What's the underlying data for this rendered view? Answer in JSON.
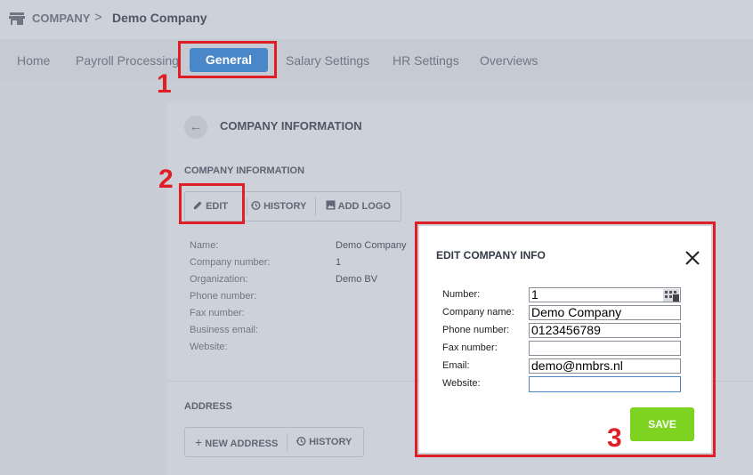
{
  "breadcrumb": {
    "root": "COMPANY",
    "separator": ">",
    "current": "Demo Company"
  },
  "nav": {
    "items": [
      "Home",
      "Payroll Processing",
      "General",
      "Salary Settings",
      "HR Settings",
      "Overviews"
    ],
    "active": "General"
  },
  "card": {
    "title": "COMPANY INFORMATION",
    "section": "COMPANY INFORMATION",
    "buttons": {
      "edit": "EDIT",
      "history": "HISTORY",
      "add_logo": "ADD LOGO"
    },
    "fields": [
      {
        "label": "Name:",
        "value": "Demo Company"
      },
      {
        "label": "Company number:",
        "value": "1"
      },
      {
        "label": "Organization:",
        "value": "Demo BV"
      },
      {
        "label": "Phone number:",
        "value": ""
      },
      {
        "label": "Fax number:",
        "value": ""
      },
      {
        "label": "Business email:",
        "value": ""
      },
      {
        "label": "Website:",
        "value": ""
      }
    ],
    "address": {
      "section": "ADDRESS",
      "new_address": "NEW ADDRESS",
      "history": "HISTORY"
    }
  },
  "modal": {
    "title": "EDIT COMPANY INFO",
    "fields": [
      {
        "label": "Number:",
        "value": "1"
      },
      {
        "label": "Company name:",
        "value": "Demo Company"
      },
      {
        "label": "Phone number:",
        "value": "0123456789"
      },
      {
        "label": "Fax number:",
        "value": ""
      },
      {
        "label": "Email:",
        "value": "demo@nmbrs.nl"
      },
      {
        "label": "Website:",
        "value": ""
      }
    ],
    "save": "SAVE"
  },
  "annotations": [
    "1",
    "2",
    "3"
  ],
  "colors": {
    "accent": "#4a87c9",
    "save": "#7ed321",
    "highlight": "#e01e26"
  }
}
